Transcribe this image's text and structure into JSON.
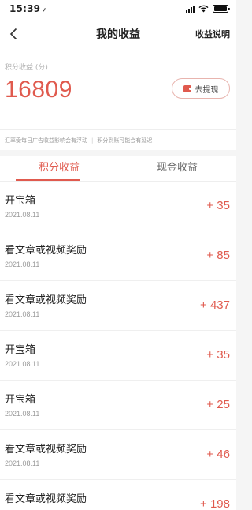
{
  "status_bar": {
    "time": "15:39",
    "location_icon": "location-arrow-icon",
    "icons": [
      "cellular-signal-icon",
      "wifi-icon",
      "battery-icon"
    ]
  },
  "nav": {
    "back_icon": "chevron-left-icon",
    "title": "我的收益",
    "right_link": "收益说明"
  },
  "summary": {
    "label": "积分收益 (分)",
    "value": "16809",
    "withdraw_label": "去提现",
    "withdraw_icon": "wallet-icon"
  },
  "notice": {
    "left": "汇率受每日广告收益影响会有浮动",
    "separator": "|",
    "right": "积分到账可能会有延迟"
  },
  "tabs": [
    {
      "label": "积分收益",
      "active": true
    },
    {
      "label": "现金收益",
      "active": false
    }
  ],
  "records": [
    {
      "title": "开宝箱",
      "date": "2021.08.11",
      "amount": "+ 35"
    },
    {
      "title": "看文章或视频奖励",
      "date": "2021.08.11",
      "amount": "+ 85"
    },
    {
      "title": "看文章或视频奖励",
      "date": "2021.08.11",
      "amount": "+ 437"
    },
    {
      "title": "开宝箱",
      "date": "2021.08.11",
      "amount": "+ 35"
    },
    {
      "title": "开宝箱",
      "date": "2021.08.11",
      "amount": "+ 25"
    },
    {
      "title": "看文章或视频奖励",
      "date": "2021.08.11",
      "amount": "+ 46"
    },
    {
      "title": "看文章或视频奖励",
      "date": "",
      "amount": "+ 198"
    }
  ],
  "colors": {
    "accent": "#e05a4e",
    "muted_text": "#9a9a9a",
    "background": "#f5f5f5"
  }
}
